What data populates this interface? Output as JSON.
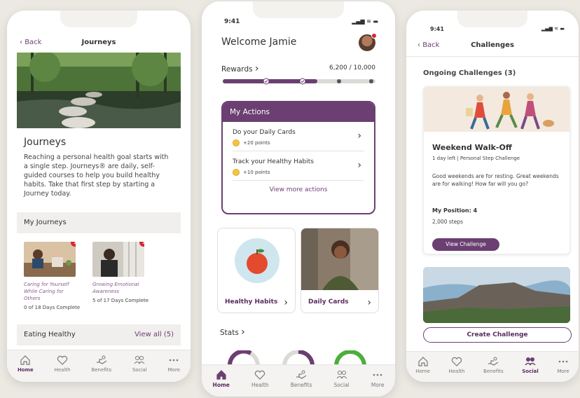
{
  "phone1": {
    "back": "Back",
    "title": "Journeys",
    "heading": "Journeys",
    "description": "Reaching a personal health goal starts with a single step. Journeys® are daily, self-guided courses to help you build healthy habits. Take that first step by starting a Journey today.",
    "my_journeys": "My Journeys",
    "cards": [
      {
        "badge": "1",
        "title": "Caring for Yourself While Caring for Others",
        "progress": "0 of 18 Days Complete"
      },
      {
        "badge": "1",
        "title": "Growing Emotional Awareness",
        "progress": "5 of 17 Days Complete"
      }
    ],
    "eating": "Eating Healthy",
    "view_all": "View all (5)",
    "tabs": [
      "Home",
      "Health",
      "Benefits",
      "Social",
      "More"
    ]
  },
  "phone2": {
    "time": "9:41",
    "status": "▂▄▆ ≋ ▬",
    "welcome": "Welcome Jamie",
    "rewards": "Rewards",
    "rewards_value": "6,200 / 10,000",
    "rewards_progress": 0.62,
    "actions_title": "My Actions",
    "actions": [
      {
        "title": "Do your Daily Cards",
        "points": "+20 points"
      },
      {
        "title": "Track your Healthy Habits",
        "points": "+10 points"
      }
    ],
    "view_more": "View more actions",
    "tile_left": "Healthy Habits",
    "tile_right": "Daily Cards",
    "stats": "Stats",
    "tabs": [
      "Home",
      "Health",
      "Benefits",
      "Social",
      "More"
    ]
  },
  "phone3": {
    "time": "9:41",
    "status": "▂▄▆ ≋ ▬",
    "back": "Back",
    "title": "Challenges",
    "ongoing": "Ongoing Challenges (3)",
    "challenge": {
      "title": "Weekend Walk-Off",
      "subtitle": "1 day left | Personal Step Challenge",
      "description": "Good weekends are for resting. Great weekends are for walking! How far will you go?",
      "position": "My Position: 4",
      "steps": "2,000 steps",
      "button": "View Challenge"
    },
    "create": "Create Challenge",
    "tabs": [
      "Home",
      "Health",
      "Benefits",
      "Social",
      "More"
    ]
  },
  "colors": {
    "brand": "#6b3f72",
    "accent_red": "#d6263a"
  }
}
